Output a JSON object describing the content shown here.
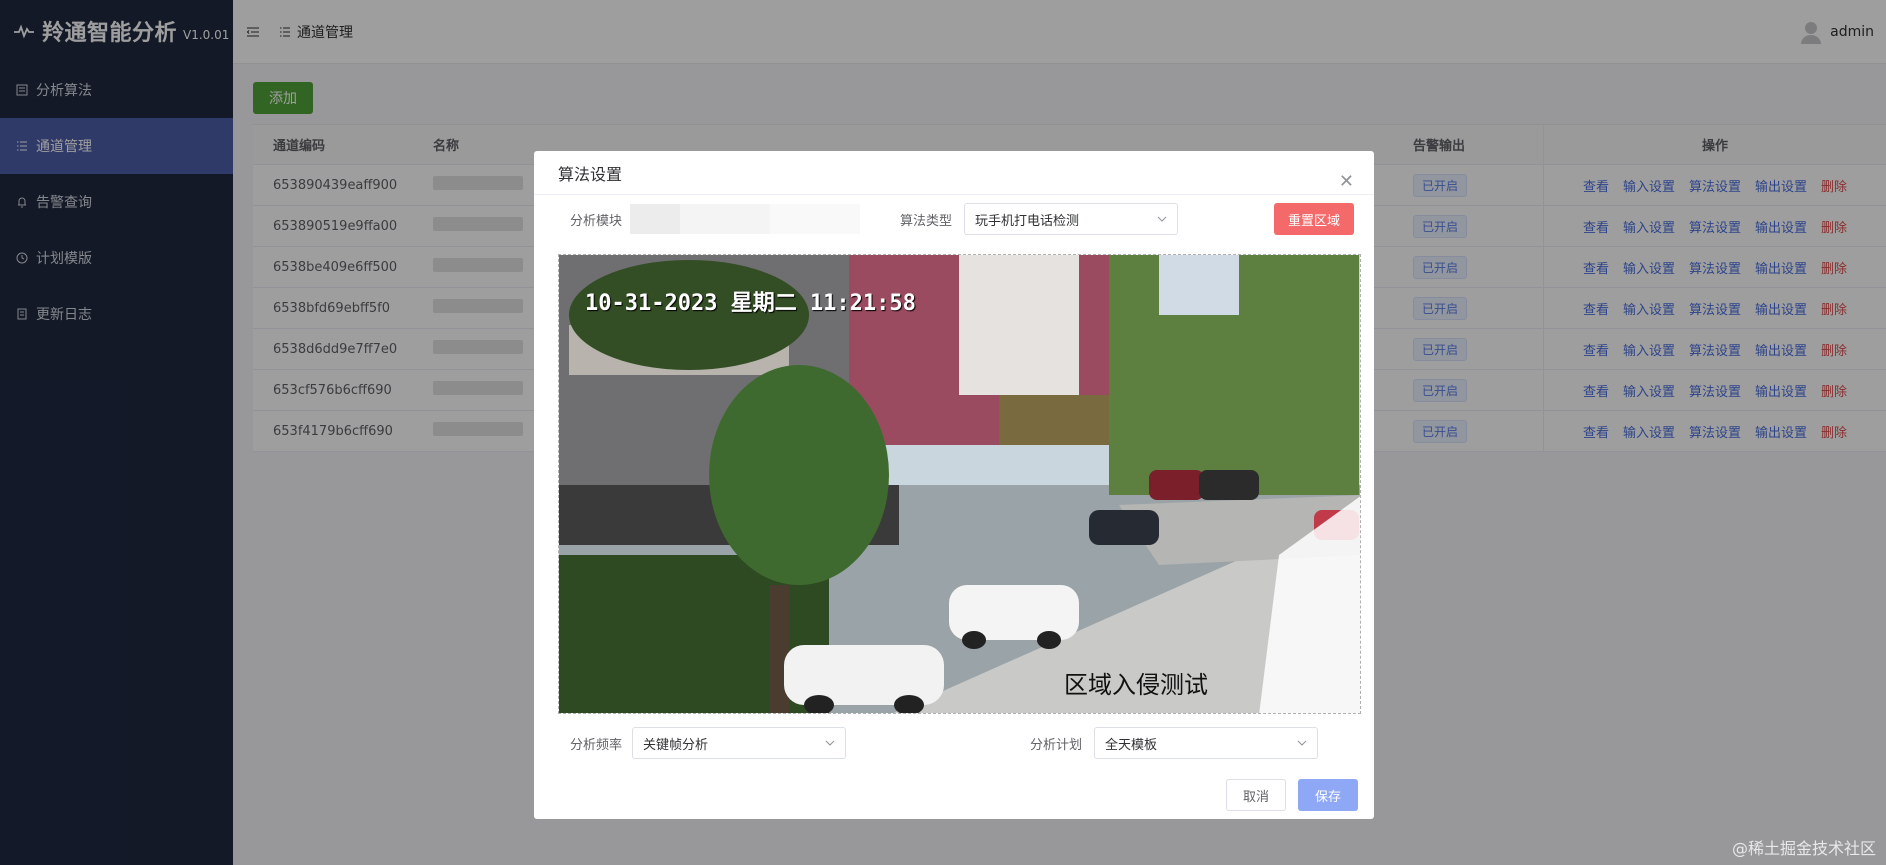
{
  "app": {
    "title": "羚通智能分析",
    "version": "V1.0.01"
  },
  "sidebar": {
    "items": [
      {
        "label": "分析算法",
        "icon": "list-icon",
        "active": false
      },
      {
        "label": "通道管理",
        "icon": "menu-list-icon",
        "active": true
      },
      {
        "label": "告警查询",
        "icon": "bell-icon",
        "active": false
      },
      {
        "label": "计划模版",
        "icon": "clock-icon",
        "active": false
      },
      {
        "label": "更新日志",
        "icon": "document-icon",
        "active": false
      }
    ]
  },
  "topbar": {
    "breadcrumb": "通道管理",
    "user": "admin"
  },
  "toolbar": {
    "add_label": "添加"
  },
  "table": {
    "columns": [
      "通道编码",
      "名称",
      "",
      "",
      "",
      "",
      "",
      "",
      "告警输出",
      "操作"
    ],
    "rows": [
      {
        "code": "653890439eaff900",
        "alarm": "已开启"
      },
      {
        "code": "653890519e9ffa00",
        "alarm": "已开启"
      },
      {
        "code": "6538be409e6ff500",
        "alarm": "已开启"
      },
      {
        "code": "6538bfd69ebff5f0",
        "alarm": "已开启"
      },
      {
        "code": "6538d6dd9e7ff7e0",
        "alarm": "已开启"
      },
      {
        "code": "653cf576b6cff690",
        "alarm": "已开启"
      },
      {
        "code": "653f4179b6cff690",
        "alarm": "已开启"
      }
    ],
    "actions": {
      "view": "查看",
      "input": "输入设置",
      "algo": "算法设置",
      "output": "输出设置",
      "delete": "删除"
    }
  },
  "dialog": {
    "title": "算法设置",
    "module_label": "分析模块",
    "algo_type_label": "算法类型",
    "algo_type_value": "玩手机打电话检测",
    "reset_label": "重置区域",
    "video_timestamp": "10-31-2023 星期二 11:21:58",
    "video_caption": "区域入侵测试",
    "freq_label": "分析频率",
    "freq_value": "关键帧分析",
    "plan_label": "分析计划",
    "plan_value": "全天模板",
    "cancel_label": "取消",
    "save_label": "保存"
  },
  "watermark": "@稀土掘金技术社区",
  "colors": {
    "sidebar": "#1f2940",
    "active": "#4d5ea8",
    "add": "#52a43a",
    "reset": "#f46a6a",
    "save": "#8fa8f5"
  }
}
